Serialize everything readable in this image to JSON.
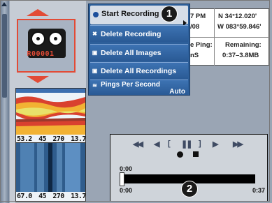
{
  "menu": {
    "start_recording": "Start Recording",
    "delete_recording": "Delete Recording",
    "delete_all_images": "Delete All Images",
    "delete_all_recordings": "Delete All Recordings",
    "pings_per_second": "Pings Per Second",
    "pings_value": "Auto"
  },
  "callouts": {
    "one": "1",
    "two": "2"
  },
  "recorder": {
    "counter": "R00001"
  },
  "info": {
    "time": "7 PM",
    "date": "/08",
    "latitude": "N 34°12.020'",
    "longitude": "W 083°59.846'",
    "ping_label": "e Ping:",
    "ping_value": "nS",
    "remaining_label": "Remaining:",
    "remaining_value": "0:37–3.8MB"
  },
  "thumbnails": [
    {
      "readouts": [
        "53.2",
        "45",
        "270",
        "13.7"
      ]
    },
    {
      "readouts": [
        "67.0",
        "45",
        "270",
        "13.7"
      ]
    }
  ],
  "playback": {
    "current_time": "0:00",
    "start_time": "0:00",
    "end_time": "0:37",
    "progress": 0.0,
    "controls": {
      "rewind": "◀◀",
      "step_back": "◀",
      "frame_back": "[",
      "pause": "❚❚",
      "frame_forward": "]",
      "play": "▶",
      "fast_forward": "▶▶"
    }
  },
  "icons": {
    "start": "record-dot-icon",
    "delete": "delete-icon",
    "images": "images-icon",
    "pings": "pings-icon"
  }
}
